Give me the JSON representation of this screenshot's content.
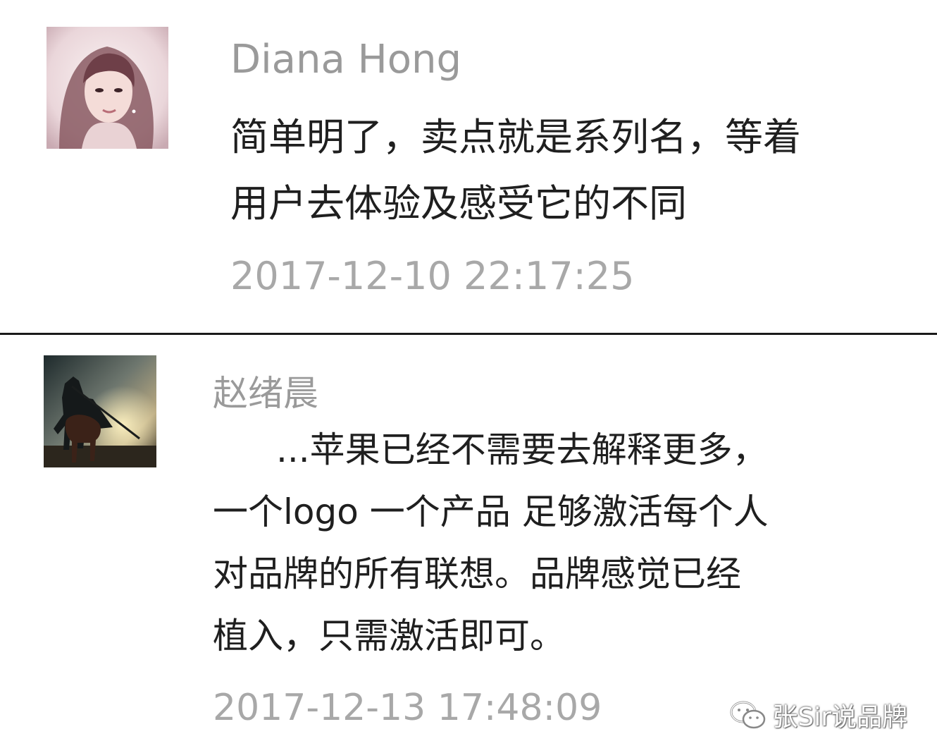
{
  "comments": [
    {
      "author": "Diana Hong",
      "lines": [
        "简单明了，卖点就是系列名，等着",
        "用户去体验及感受它的不同"
      ],
      "timestamp": "2017-12-10 22:17:25",
      "avatar_icon": "woman-portrait-avatar"
    },
    {
      "author": "赵绪晨",
      "lines": [
        "...苹果已经不需要去解释更多，",
        "一个logo 一个产品 足够激活每个人",
        "对品牌的所有联想。品牌感觉已经",
        "植入，只需激活即可。"
      ],
      "timestamp": "2017-12-13 17:48:09",
      "avatar_icon": "horseman-silhouette-avatar"
    }
  ],
  "watermark": {
    "text": "张Sir说品牌",
    "icon": "wechat-icon"
  },
  "colors": {
    "author": "#9a9a9a",
    "body": "#1f1f1f",
    "timestamp": "#a8a8a8",
    "divider": "#1a1a1a"
  }
}
